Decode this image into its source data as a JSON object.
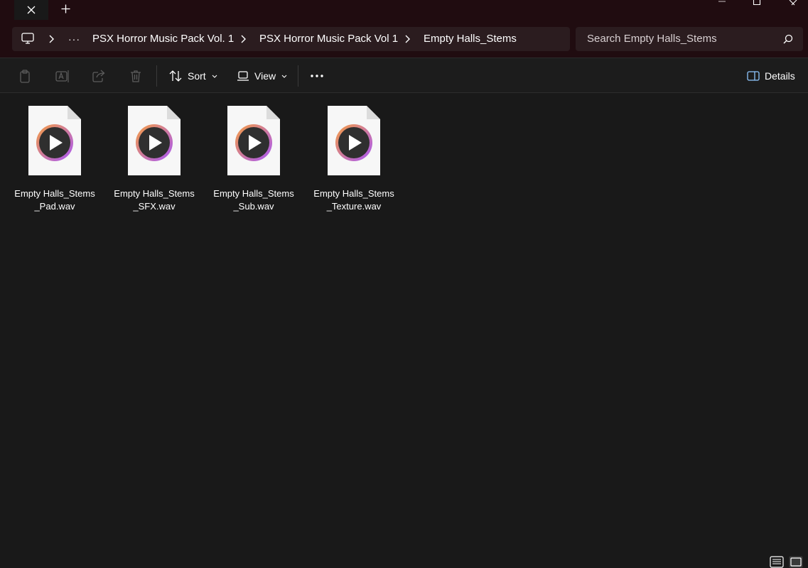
{
  "window": {
    "tab_close_icon": "close-icon",
    "new_tab_icon": "plus-icon",
    "controls": [
      "minimize-icon",
      "maximize-icon",
      "close-icon"
    ]
  },
  "address_bar": {
    "root_icon": "computer-icon",
    "overflow": "···",
    "breadcrumbs": [
      "PSX Horror Music Pack Vol. 1",
      "PSX Horror Music Pack Vol 1",
      "Empty Halls_Stems"
    ]
  },
  "search": {
    "placeholder": "Search Empty Halls_Stems",
    "icon": "search-icon"
  },
  "toolbar": {
    "actions": [
      "paste-icon",
      "rename-icon",
      "share-icon",
      "delete-icon"
    ],
    "sort_label": "Sort",
    "view_label": "View",
    "more": "see-more-icon",
    "details_label": "Details"
  },
  "files": [
    {
      "name": "Empty Halls_Stems_Pad.wav",
      "type": "wav"
    },
    {
      "name": "Empty Halls_Stems_SFX.wav",
      "type": "wav"
    },
    {
      "name": "Empty Halls_Stems_Sub.wav",
      "type": "wav"
    },
    {
      "name": "Empty Halls_Stems_Texture.wav",
      "type": "wav"
    }
  ],
  "statusbar": {
    "view_modes": [
      "details-view-icon",
      "tiles-view-icon"
    ],
    "active_view": "tiles"
  },
  "colors": {
    "titlebar": "#200c10",
    "field": "#2b1c1f",
    "background": "#191919",
    "accent_ring_start": "#f59e42",
    "accent_ring_end": "#a855f7"
  }
}
